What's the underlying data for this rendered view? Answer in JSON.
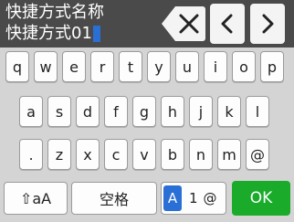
{
  "header": {
    "title": "快捷方式名称",
    "input_value": "快捷方式01",
    "backspace_icon": "backspace-icon",
    "left_icon": "chevron-left-icon",
    "right_icon": "chevron-right-icon"
  },
  "keyboard": {
    "row1": [
      "q",
      "w",
      "e",
      "r",
      "t",
      "y",
      "u",
      "i",
      "o",
      "p"
    ],
    "row2": [
      "a",
      "s",
      "d",
      "f",
      "g",
      "h",
      "j",
      "k",
      "l"
    ],
    "row3": [
      ".",
      "z",
      "x",
      "c",
      "v",
      "b",
      "n",
      "m",
      "@"
    ],
    "shift_label": "⇧aA",
    "space_label": "空格",
    "mode_a": "A",
    "mode_1": "1",
    "mode_at": "@",
    "ok_label": "OK"
  },
  "colors": {
    "header_bg": "#4a4a4a",
    "keyboard_bg": "#d4d4d4",
    "accent_blue": "#2a6fd6",
    "ok_green": "#1aab2b"
  }
}
